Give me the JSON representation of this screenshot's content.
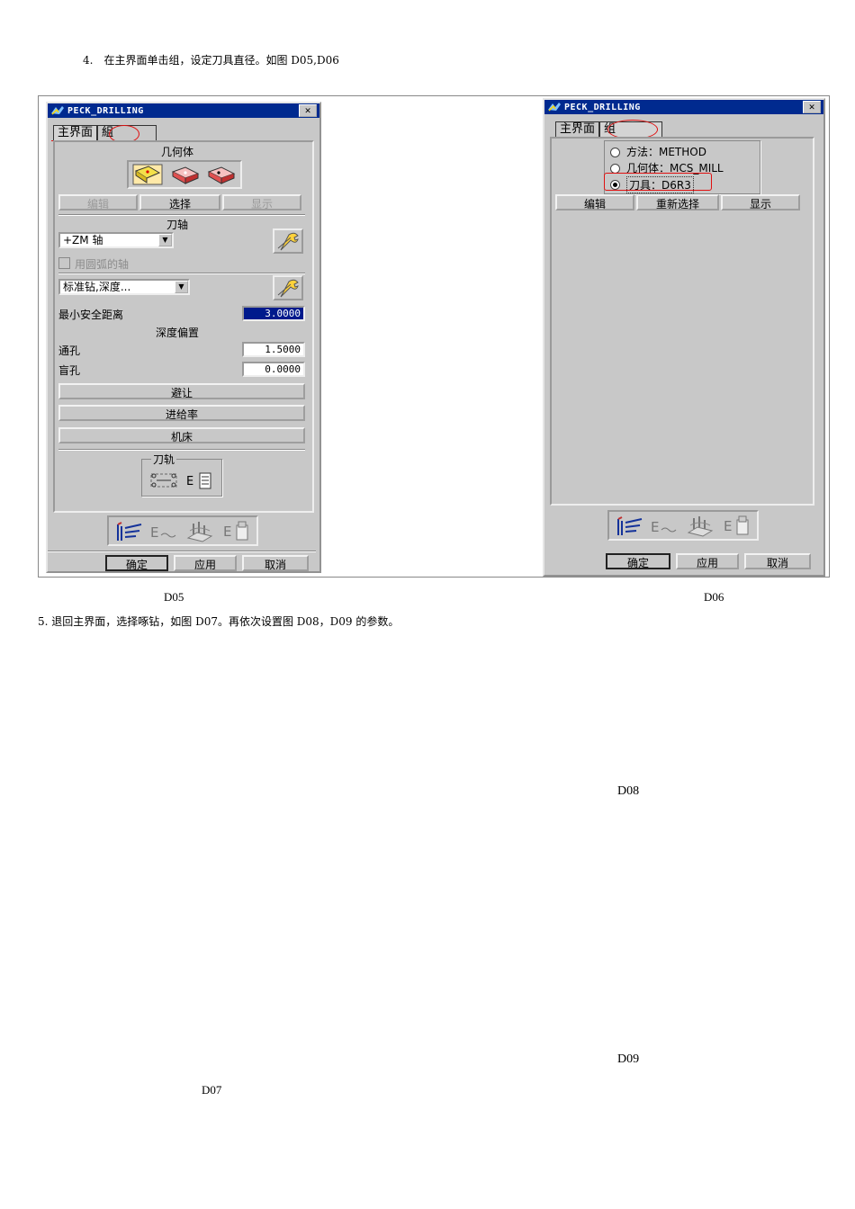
{
  "doc": {
    "step4": "4.　在主界面单击组，设定刀具直径。如图 D05,D06",
    "step5": "5. 退回主界面，选择啄钻，如图 D07。再依次设置图 D08，D09 的参数。",
    "captions": {
      "d05": "D05",
      "d06": "D06",
      "d07": "D07",
      "d08": "D08",
      "d09": "D09"
    }
  },
  "dialog_left": {
    "title": "PECK_DRILLING",
    "close_glyph": "✕",
    "tabs": [
      "主界面",
      "組"
    ],
    "geometry_heading": "几何体",
    "geo_buttons": [
      "编辑",
      "选择",
      "显示"
    ],
    "axis_heading": "刀轴",
    "axis_value": "+ZM 轴",
    "arc_axis_label": "用圆弧的轴",
    "cycle_value": "标准钻,深度...",
    "min_clearance_label": "最小安全距离",
    "min_clearance_value": "3.0000",
    "depth_offset_heading": "深度偏置",
    "through_hole_label": "通孔",
    "through_hole_value": "1.5000",
    "blind_hole_label": "盲孔",
    "blind_hole_value": "0.0000",
    "buttons": [
      "避让",
      "进给率",
      "机床"
    ],
    "toolpath_group": "刀轨",
    "bottom": [
      "确定",
      "应用",
      "取消"
    ]
  },
  "dialog_right": {
    "title": "PECK_DRILLING",
    "close_glyph": "✕",
    "tabs": [
      "主界面",
      "组"
    ],
    "options": [
      "方法：METHOD",
      "几何体：MCS_MILL",
      "刀具：D6R3"
    ],
    "selected_option": 2,
    "group_buttons": [
      "编辑",
      "重新选择",
      "显示"
    ],
    "bottom": [
      "确定",
      "应用",
      "取消"
    ]
  },
  "colors": {
    "titlebar": "#002a8f",
    "highlight": "#e01010",
    "dialog": "#c8c8c8"
  }
}
